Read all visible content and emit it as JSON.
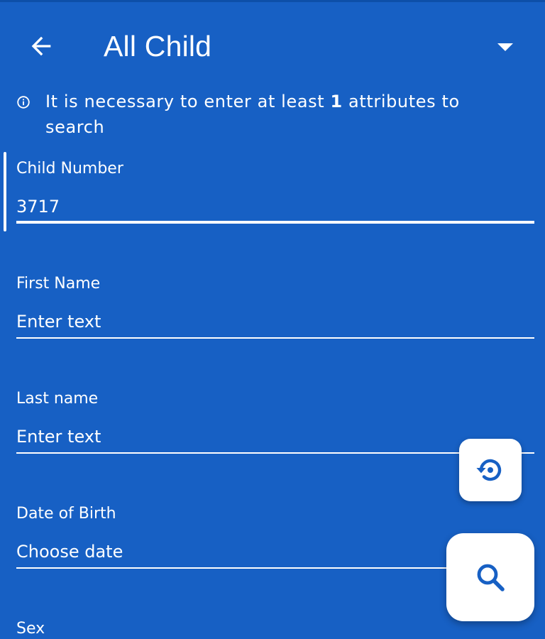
{
  "header": {
    "back_icon": "arrow-left-icon",
    "title": "All Child",
    "dropdown_icon": "caret-down-icon"
  },
  "info": {
    "icon": "info-icon",
    "text_before": "It is necessary to enter at least ",
    "count": "1",
    "text_after": " attributes to search"
  },
  "fields": [
    {
      "label": "Child Number",
      "value": "3717",
      "placeholder": ""
    },
    {
      "label": "First Name",
      "value": "",
      "placeholder": "Enter text"
    },
    {
      "label": "Last name",
      "value": "",
      "placeholder": "Enter text"
    },
    {
      "label": "Date of Birth",
      "value": "",
      "placeholder": "Choose date"
    },
    {
      "label": "Sex",
      "value": "",
      "placeholder": ""
    }
  ],
  "actions": {
    "reset_icon": "restore-history-icon",
    "search_icon": "search-icon"
  },
  "colors": {
    "background": "#1760c4",
    "foreground": "#ffffff",
    "fab_background": "#ffffff",
    "fab_icon": "#1760c4"
  }
}
